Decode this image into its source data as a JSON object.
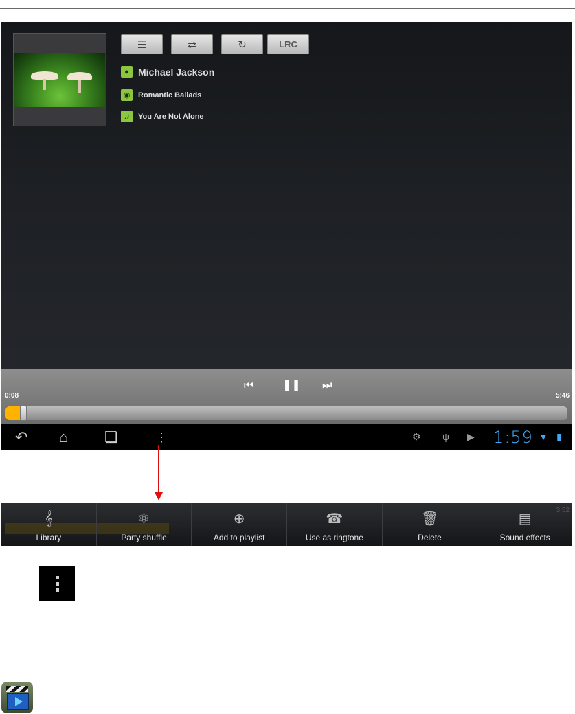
{
  "player": {
    "toolbar": {
      "queue_icon": "list-icon",
      "shuffle_icon": "shuffle-icon",
      "repeat_icon": "repeat-icon",
      "lrc_label": "LRC"
    },
    "artist": "Michael Jackson",
    "album": "Romantic Ballads",
    "song": "You Are Not Alone",
    "elapsed": "0:08",
    "duration": "5:46",
    "progress_fraction": 0.023,
    "accent_color": "#ffb300"
  },
  "status_bar": {
    "clock": "1:59",
    "clock_color": "#3fa9f5"
  },
  "action_bar": {
    "items": [
      {
        "label": "Library",
        "icon": "library-icon"
      },
      {
        "label": "Party shuffle",
        "icon": "party-shuffle-icon"
      },
      {
        "label": "Add to playlist",
        "icon": "add-icon"
      },
      {
        "label": "Use as ringtone",
        "icon": "ringtone-icon"
      },
      {
        "label": "Delete",
        "icon": "delete-icon"
      },
      {
        "label": "Sound effects",
        "icon": "equalizer-icon"
      }
    ],
    "background_time": "3:52"
  }
}
